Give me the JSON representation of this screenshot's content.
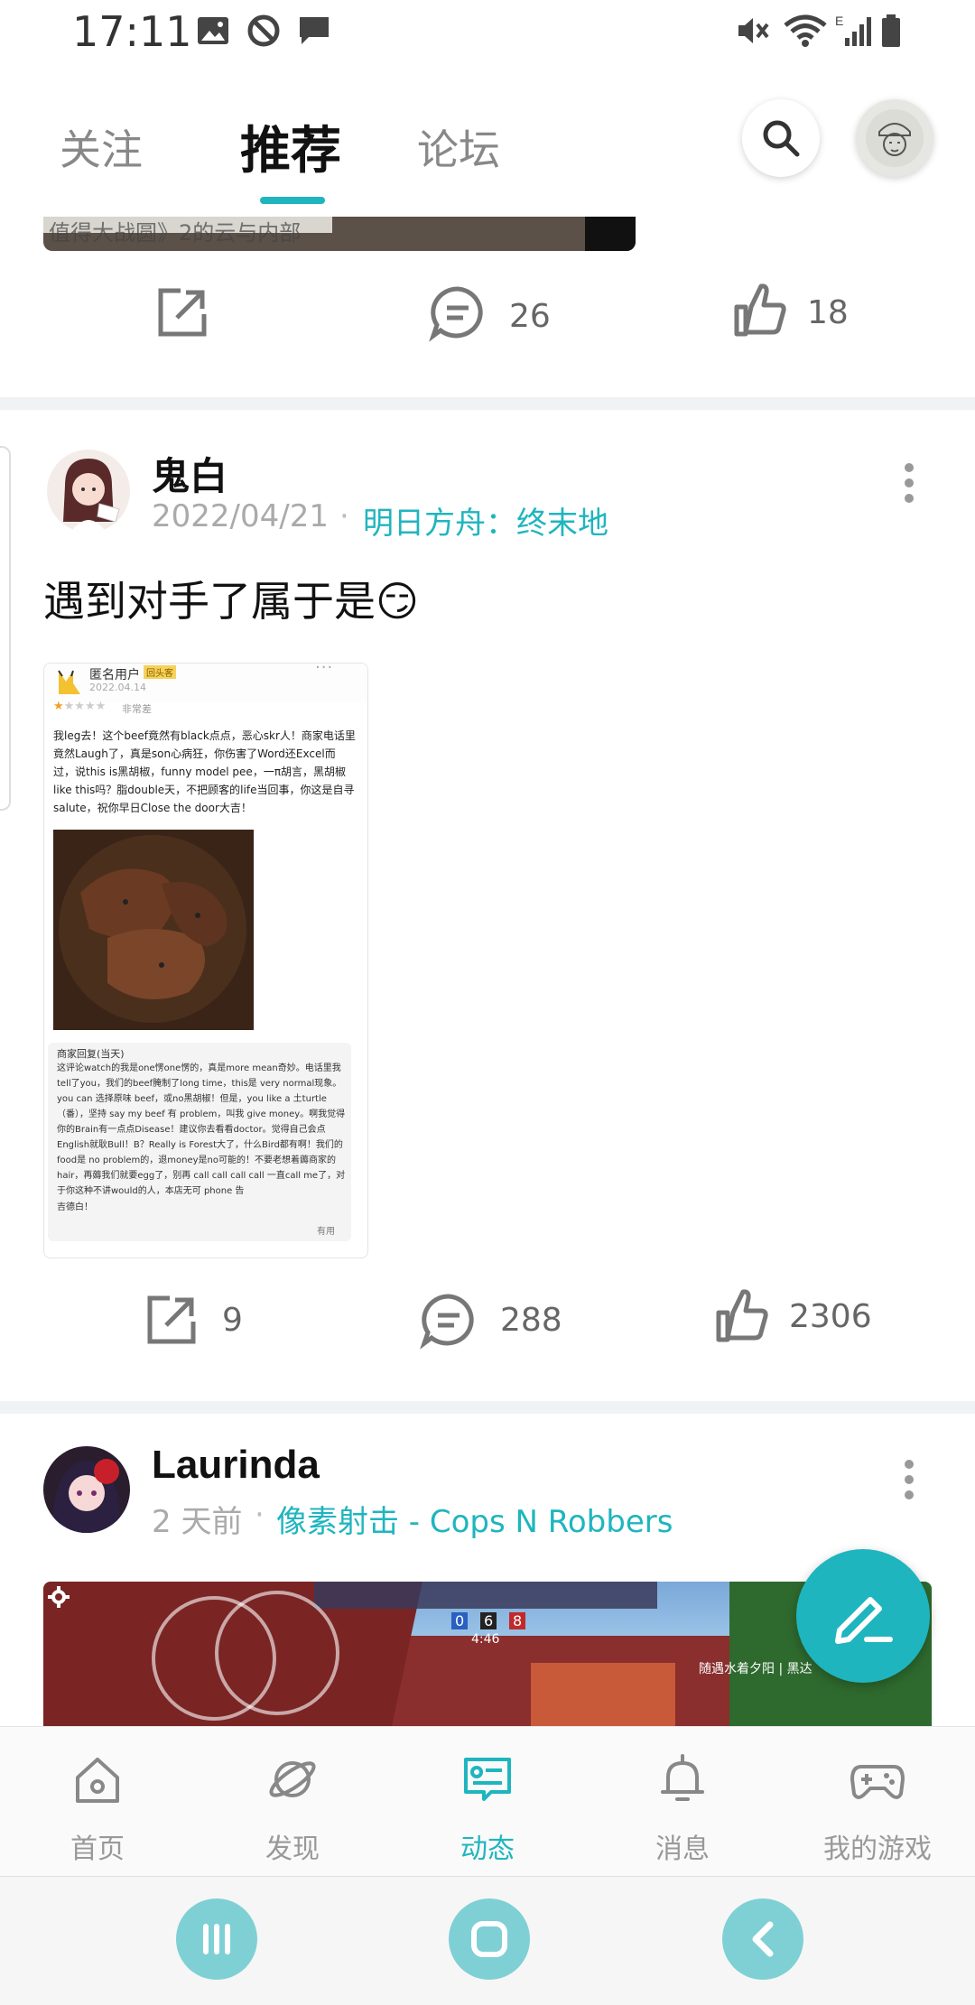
{
  "status_bar": {
    "time": "17:11"
  },
  "top_tabs": [
    {
      "label": "关注",
      "active": false
    },
    {
      "label": "推荐",
      "active": true
    },
    {
      "label": "论坛",
      "active": false
    }
  ],
  "search": {
    "icon": "search-icon"
  },
  "previous_post": {
    "image_caption": "值得大战圆》2的云与内部",
    "share_count": "",
    "comment_count": "26",
    "like_count": "18"
  },
  "posts": [
    {
      "author": "鬼白",
      "date": "2022/04/21",
      "separator": "·",
      "game": "明日方舟：终末地",
      "text": "遇到对手了属于是😏",
      "screenshot": {
        "user": "匿名用户",
        "badge": "回头客",
        "date": "2022.04.14",
        "rating_label": "非常差",
        "review": "我leg去！这个beef竟然有black点点，恶心skr人！商家电话里竟然Laugh了，真是son心病狂，你伤害了Word还Excel而过，说this is黑胡椒，funny model pee，一π胡言，黑胡椒like this吗？脂double天，不把顾客的life当回事，你这是自寻salute，祝你早日Close the door大吉！",
        "reply_title": "商家回复(当天)",
        "reply": "这评论watch的我是one愣one愣的，真是more mean奇妙。电话里我tell了you，我们的beef腌制了long time，this是 very normal现象。you can 选择原味 beef，或no黑胡椒！但是，you like a 土turtle（番），坚持 say my beef 有 problem，叫我 give money。啊我觉得你的Brain有一点点Disease！建议你去看看doctor。觉得自己会点English就耿Bull！B？Really is Forest大了，什么Bird都有啊！我们的food是 no problem的，退money是no可能的！不要老想着薅商家的hair，再薅我们就要egg了，别再 call call call call 一直call me了，对于你这种不讲would的人，本店无可 phone 告",
        "reply_end": "吉德白！",
        "helpful": "有用"
      },
      "share_count": "9",
      "comment_count": "288",
      "like_count": "2306"
    },
    {
      "author": "Laurinda",
      "date": "2 天前",
      "separator": "·",
      "game": "像素射击 - Cops N Robbers",
      "game_hud": {
        "score_left": "0",
        "score_mid": "6",
        "score_right": "8",
        "timer": "4:46",
        "caption": "随遇水着夕阳 | 黑达"
      }
    }
  ],
  "fab": {
    "icon": "pen-icon"
  },
  "bottom_nav": [
    {
      "label": "首页",
      "icon": "home-icon",
      "active": false
    },
    {
      "label": "发现",
      "icon": "planet-icon",
      "active": false
    },
    {
      "label": "动态",
      "icon": "feed-card-icon",
      "active": true
    },
    {
      "label": "消息",
      "icon": "bell-icon",
      "active": false
    },
    {
      "label": "我的游戏",
      "icon": "gamepad-icon",
      "active": false
    }
  ],
  "colors": {
    "accent": "#1fb5bf",
    "divider": "#f1f2f4",
    "text_primary": "#111111",
    "text_muted": "#999999"
  }
}
